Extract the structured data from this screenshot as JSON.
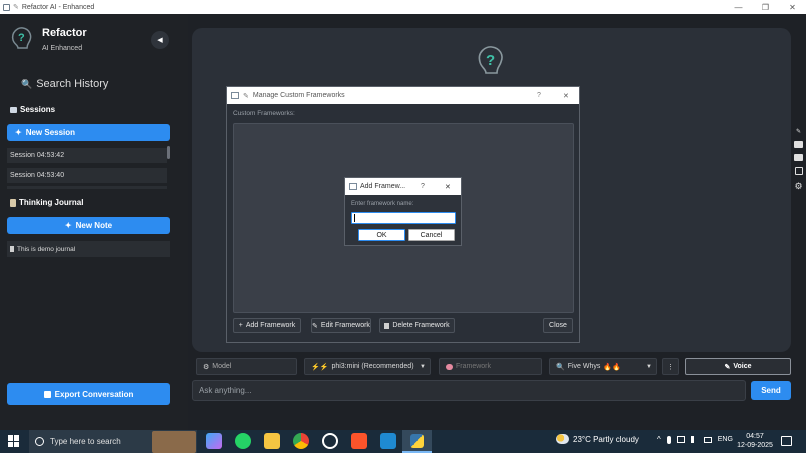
{
  "window": {
    "title": "Refactor AI - Enhanced",
    "minimize": "—",
    "maximize": "❐",
    "close": "✕"
  },
  "sidebar": {
    "app_name": "Refactor",
    "app_subtitle": "AI Enhanced",
    "collapse_glyph": "◀",
    "search_history": "Search History",
    "sessions_heading": "Sessions",
    "new_session": "New Session",
    "sessions": [
      "Session 04:53:42",
      "Session 04:53:40"
    ],
    "journal_heading": "Thinking Journal",
    "new_note": "New Note",
    "journal_items": [
      "This is demo journal"
    ],
    "export": "Export Conversation"
  },
  "manage_dialog": {
    "title": "Manage Custom Frameworks",
    "help": "?",
    "close_glyph": "✕",
    "list_label": "Custom Frameworks:",
    "add": "Add Framework",
    "edit": "Edit Framework",
    "delete": "Delete Framework",
    "close": "Close"
  },
  "add_dialog": {
    "title": "Add Framew...",
    "help": "?",
    "close_glyph": "✕",
    "prompt": "Enter framework name:",
    "input_value": "",
    "ok": "OK",
    "cancel": "Cancel"
  },
  "bottom": {
    "model_label": "Model",
    "model_value": "phi3:mini (Recommended)",
    "framework_label": "Framework",
    "technique_value": "Five Whys",
    "more": "⋮",
    "voice": "Voice",
    "input_placeholder": "Ask anything...",
    "send": "Send"
  },
  "taskbar": {
    "search_placeholder": "Type here to search",
    "weather": "23°C  Partly cloudy",
    "lang": "ENG",
    "time": "04:57",
    "date": "12-09-2025"
  },
  "colors": {
    "accent": "#2d8cf0",
    "panel": "#2b3038",
    "sidebar": "#1f2226",
    "taskbar": "#1a2b3a"
  }
}
